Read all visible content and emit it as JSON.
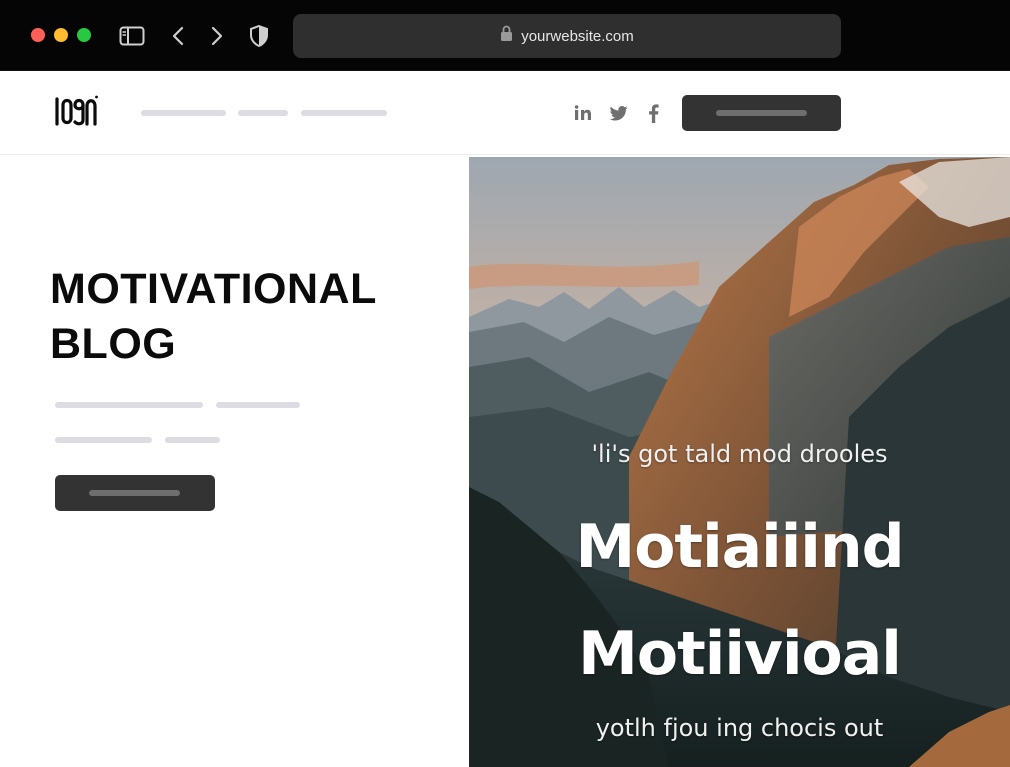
{
  "browser": {
    "url": "yourwebsite.com",
    "icons": [
      "sidebar-icon",
      "back-icon",
      "forward-icon",
      "shield-icon",
      "lock-icon"
    ]
  },
  "header": {
    "logo_text": "LOGO",
    "social": [
      "linkedin-icon",
      "twitter-icon",
      "facebook-icon"
    ]
  },
  "hero": {
    "title_line1": "MOTIVATIONAL",
    "title_line2": "BLOG"
  },
  "image": {
    "caption_top": "'li's got tald mod drooles",
    "headline_1": "Motiaiiind",
    "headline_2": "Motiivioal",
    "caption_bottom": "yotlh fjou ing chocis out"
  },
  "colors": {
    "chrome": "#050505",
    "address_bar": "#2f2f30",
    "button": "#333333",
    "placeholder": "#dcdce2",
    "title": "#0b0b0b"
  }
}
